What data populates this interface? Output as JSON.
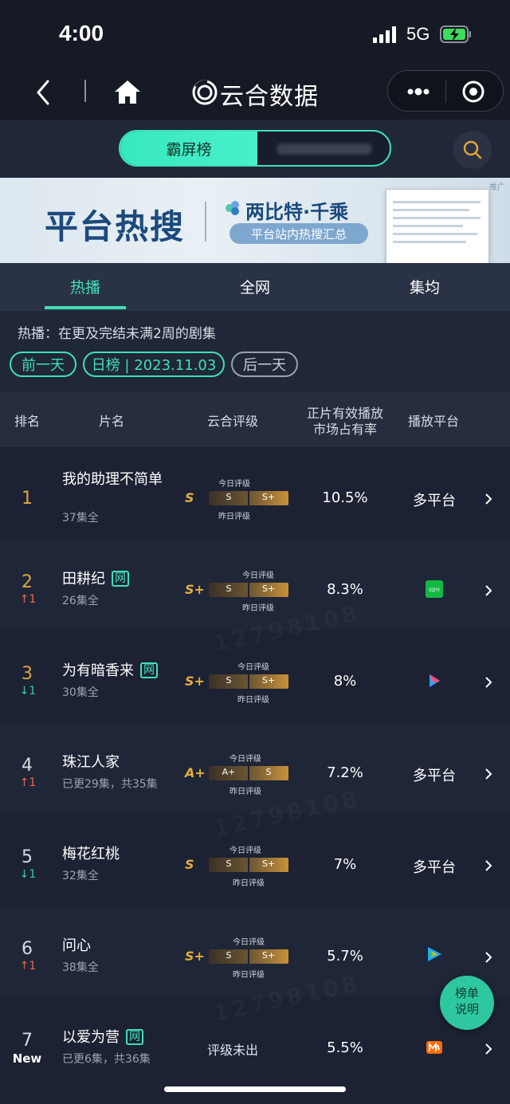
{
  "status": {
    "time": "4:00",
    "network": "5G"
  },
  "appbar": {
    "title": "云合数据"
  },
  "toggle": {
    "active_label": "霸屏榜"
  },
  "banner": {
    "headline": "平台热搜",
    "brand": "两比特·千乘",
    "pill": "平台站内热搜汇总",
    "ad": "推广"
  },
  "tabs": [
    {
      "label": "热播"
    },
    {
      "label": "全网"
    },
    {
      "label": "集均"
    }
  ],
  "description": "热播：在更及完结未满2周的剧集",
  "date_controls": {
    "prev": "前一天",
    "current": "日榜 | 2023.11.03",
    "next": "后一天"
  },
  "table_header": {
    "rank": "排名",
    "name": "片名",
    "rating": "云合评级",
    "share_line1": "正片有效播放",
    "share_line2": "市场占有率",
    "platform": "播放平台"
  },
  "gauge_labels": {
    "today": "今日评级",
    "yesterday": "昨日评级"
  },
  "rows": [
    {
      "rank": "1",
      "name": "我的助理不简单",
      "episodes": "37集全",
      "grade": "S",
      "gauge_left": "S",
      "gauge_right": "S+",
      "share": "10.5%",
      "platform": "多平台",
      "change": ""
    },
    {
      "rank": "2",
      "name": "田耕纪",
      "badge": "网",
      "episodes": "26集全",
      "grade": "S+",
      "gauge_left": "S",
      "gauge_right": "S+",
      "share": "8.3%",
      "platform_icon": "iqiyi-icon",
      "change": "1",
      "direction": "up"
    },
    {
      "rank": "3",
      "name": "为有暗香来",
      "badge": "网",
      "episodes": "30集全",
      "grade": "S+",
      "gauge_left": "S",
      "gauge_right": "S+",
      "share": "8%",
      "platform_icon": "youku-icon",
      "change": "1",
      "direction": "down"
    },
    {
      "rank": "4",
      "name": "珠江人家",
      "episodes": "已更29集，共35集",
      "grade": "A+",
      "gauge_left": "A+",
      "gauge_right": "S",
      "share": "7.2%",
      "platform": "多平台",
      "change": "1",
      "direction": "up"
    },
    {
      "rank": "5",
      "name": "梅花红桃",
      "episodes": "32集全",
      "grade": "S",
      "gauge_left": "S",
      "gauge_right": "S+",
      "share": "7%",
      "platform": "多平台",
      "change": "1",
      "direction": "down"
    },
    {
      "rank": "6",
      "name": "问心",
      "episodes": "38集全",
      "grade": "S+",
      "gauge_left": "S",
      "gauge_right": "S+",
      "share": "5.7%",
      "platform_icon": "tencent-video-icon",
      "change": "1",
      "direction": "up"
    },
    {
      "rank": "7",
      "name": "以爱为营",
      "badge": "网",
      "episodes": "已更6集，共36集",
      "unrated": "评级未出",
      "share": "5.5%",
      "platform_icon": "mgtv-icon",
      "change": "New",
      "direction": "new"
    }
  ],
  "fab": {
    "line1": "榜单",
    "line2": "说明"
  },
  "watermark": "12798108",
  "colors": {
    "accent": "#3fe0b7",
    "gold": "#e0a53a",
    "up": "#e46a4b",
    "down": "#40c9a0"
  }
}
